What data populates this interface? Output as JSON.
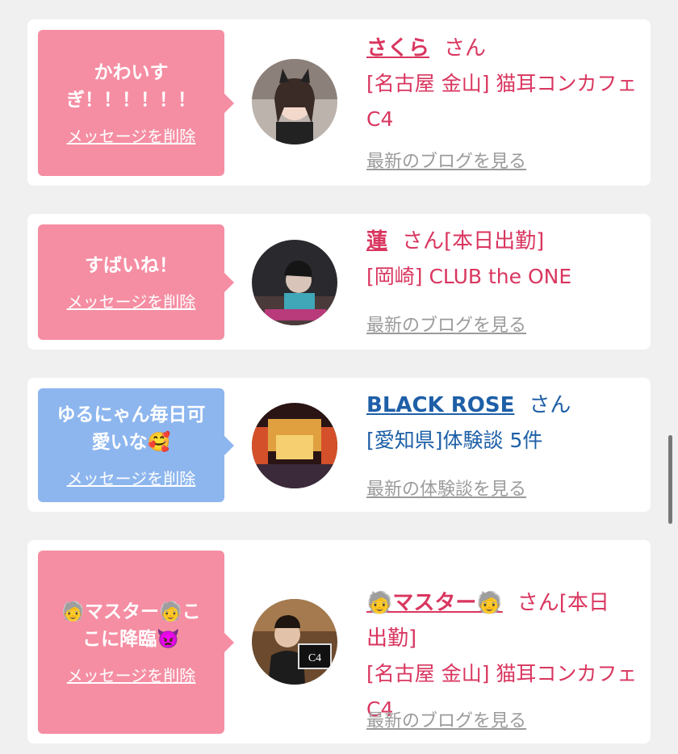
{
  "cards": [
    {
      "message": "かわいす\nぎ！！！！！！",
      "delete_label": "メッセージを削除",
      "name": "さくら",
      "san": "さん",
      "detail": "[名古屋 金山] 猫耳コンカフェ C4",
      "more": "最新のブログを見る",
      "color": "#f58ea3"
    },
    {
      "message": "すばいね！",
      "delete_label": "メッセージを削除",
      "name": "蓮",
      "san": "さん[本日出勤]",
      "detail": "[岡崎] CLUB the ONE",
      "more": "最新のブログを見る",
      "color": "#f58ea3"
    },
    {
      "message": "ゆるにゃん毎日可\n愛いな🥰",
      "delete_label": "メッセージを削除",
      "name": "BLACK ROSE",
      "san": "さん",
      "detail": "[愛知県]体験談 5件",
      "more": "最新の体験談を見る",
      "color": "#8db6ef"
    },
    {
      "message": "🧓マスター🧓こ\nこに降臨👿",
      "delete_label": "メッセージを削除",
      "name": "🧓マスター🧓",
      "san": "さん[本日\n出勤]",
      "detail": "[名古屋 金山] 猫耳コンカフェ C4",
      "more": "最新のブログを見る",
      "color": "#f58ea3"
    }
  ],
  "icons": {
    "avatar_1": "avatar-girl-cat-ears",
    "avatar_2": "avatar-host",
    "avatar_3": "avatar-stage",
    "avatar_4": "avatar-master-c4-sign"
  }
}
